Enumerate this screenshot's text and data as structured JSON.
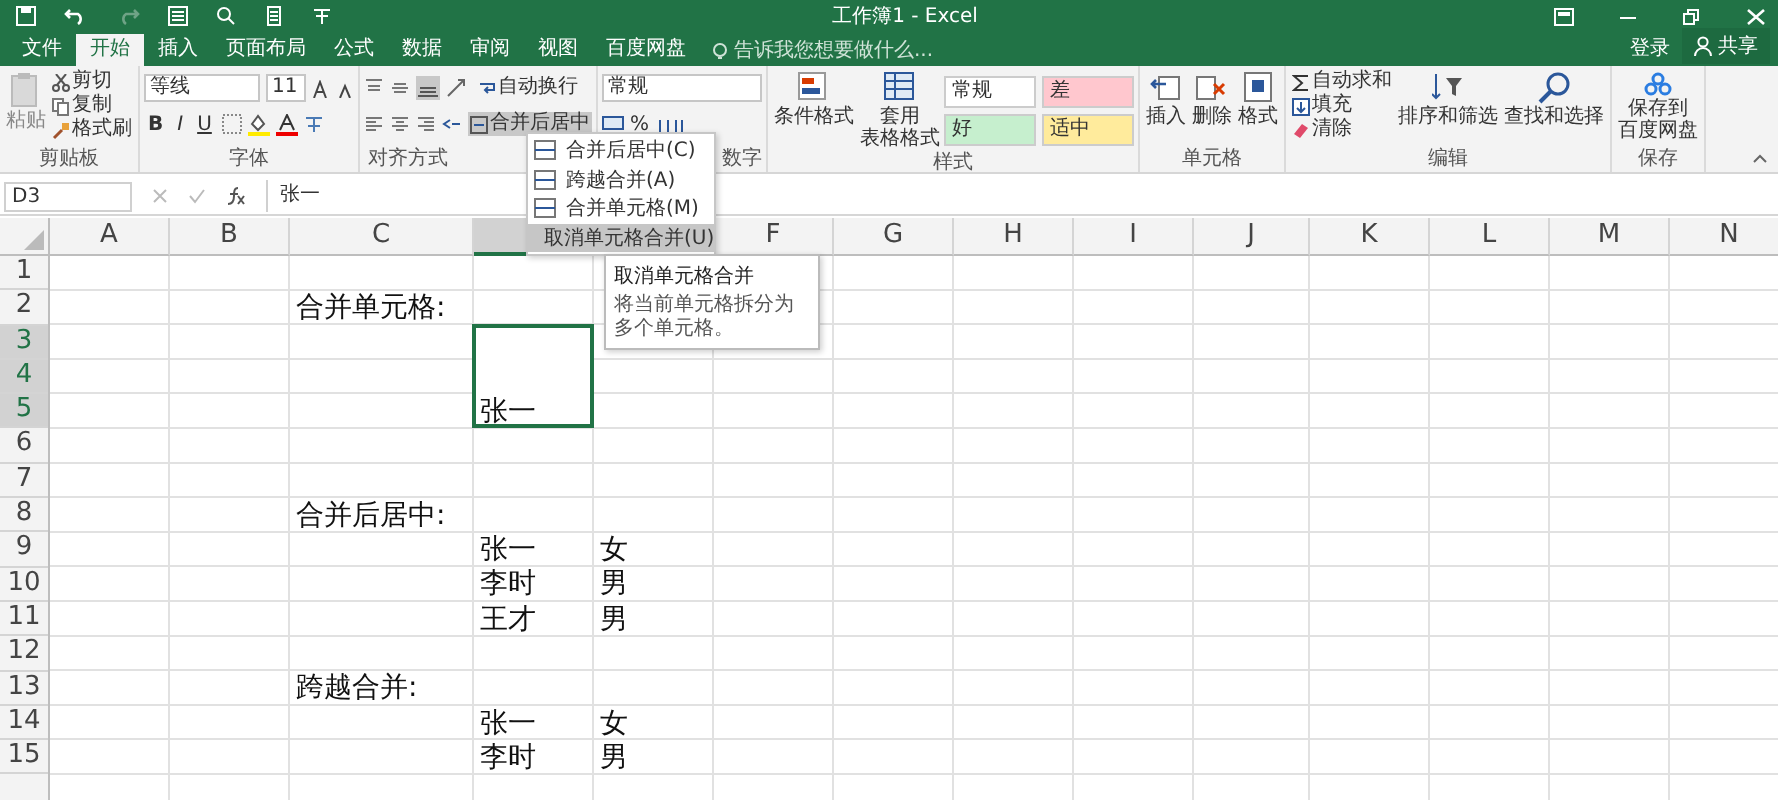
{
  "window": {
    "title": "工作簿1 - Excel"
  },
  "tabs": [
    {
      "label": "文件",
      "selected": false
    },
    {
      "label": "开始",
      "selected": true
    },
    {
      "label": "插入",
      "selected": false
    },
    {
      "label": "页面布局",
      "selected": false
    },
    {
      "label": "公式",
      "selected": false
    },
    {
      "label": "数据",
      "selected": false
    },
    {
      "label": "审阅",
      "selected": false
    },
    {
      "label": "视图",
      "selected": false
    },
    {
      "label": "百度网盘",
      "selected": false
    }
  ],
  "tell_me": {
    "placeholder": "告诉我您想要做什么..."
  },
  "account": {
    "sign_in": "登录",
    "share": "共享"
  },
  "ribbon": {
    "clipboard": {
      "label": "剪贴板",
      "paste": "粘贴",
      "cut": "剪切",
      "copy": "复制",
      "format_painter": "格式刷"
    },
    "font": {
      "label": "字体",
      "font_name": "等线",
      "font_size": "11",
      "bold": "B",
      "italic": "I",
      "underline": "U"
    },
    "alignment": {
      "label": "对齐方式",
      "wrap_text": "自动换行",
      "merge_center": "合并后居中"
    },
    "number": {
      "label": "数字",
      "format": "常规",
      "percent": "%"
    },
    "styles": {
      "label": "样式",
      "conditional": [
        "条件格式"
      ],
      "format_table": [
        "套用",
        "表格格式"
      ],
      "cell_styles": [
        {
          "label": "常规",
          "color": "#ffffff"
        },
        {
          "label": "差",
          "color": "#ffc7ce"
        },
        {
          "label": "好",
          "color": "#c6efce"
        },
        {
          "label": "适中",
          "color": "#ffeb9c"
        }
      ]
    },
    "cells": {
      "label": "单元格",
      "insert": "插入",
      "delete": "删除",
      "format": "格式"
    },
    "editing": {
      "label": "编辑",
      "autosum": "自动求和",
      "fill": "填充",
      "clear": "清除",
      "sort_filter": "排序和筛选",
      "find_select": "查找和选择"
    },
    "save": {
      "label": "保存",
      "save_to": [
        "保存到",
        "百度网盘"
      ]
    }
  },
  "formula_bar": {
    "name_box": "D3",
    "value": "张一"
  },
  "sheet": {
    "columns": [
      {
        "label": "A",
        "selected": false
      },
      {
        "label": "B",
        "selected": false
      },
      {
        "label": "C",
        "selected": false
      },
      {
        "selected": true
      },
      {},
      {
        "label": "F",
        "selected": false
      },
      {
        "label": "G",
        "selected": false
      },
      {
        "label": "H",
        "selected": false
      },
      {
        "label": "I",
        "selected": false
      },
      {
        "label": "J",
        "selected": false
      },
      {
        "label": "K",
        "selected": false
      },
      {
        "label": "L",
        "selected": false
      },
      {
        "label": "M",
        "selected": false
      },
      {
        "label": "N",
        "selected": false
      }
    ],
    "rows": [
      {
        "label": "1",
        "selected": false
      },
      {
        "label": "2",
        "selected": false,
        "cells": {
          "C": "合并单元格:"
        }
      },
      {
        "label": "3",
        "selected": true
      },
      {
        "label": "4",
        "selected": true
      },
      {
        "label": "5",
        "selected": true,
        "cells": {
          "D": "张一"
        }
      },
      {
        "label": "6",
        "selected": false
      },
      {
        "label": "7",
        "selected": false
      },
      {
        "label": "8",
        "selected": false,
        "cells": {
          "C": "合并后居中:"
        }
      },
      {
        "label": "9",
        "selected": false,
        "cells": {
          "D": "张一",
          "E": "女"
        }
      },
      {
        "label": "10",
        "selected": false,
        "cells": {
          "D": "李时",
          "E": "男"
        }
      },
      {
        "label": "11",
        "selected": false,
        "cells": {
          "D": "王才",
          "E": "男"
        }
      },
      {
        "label": "12",
        "selected": false
      },
      {
        "label": "13",
        "selected": false,
        "cells": {
          "C": "跨越合并:"
        }
      },
      {
        "label": "14",
        "selected": false,
        "cells": {
          "D": "张一",
          "E": "女"
        }
      },
      {
        "label": "15",
        "selected": false,
        "cells": {
          "D": "李时",
          "E": "男"
        }
      }
    ]
  },
  "merge_menu": {
    "items": [
      {
        "label": "合并后居中(C)",
        "selected": false
      },
      {
        "label": "跨越合并(A)",
        "selected": false
      },
      {
        "label": "合并单元格(M)",
        "selected": false
      },
      {
        "label": "取消单元格合并(U)",
        "selected": true
      }
    ]
  },
  "tooltip": {
    "title": "取消单元格合并",
    "text": "将当前单元格拆分为多个单元格。"
  }
}
